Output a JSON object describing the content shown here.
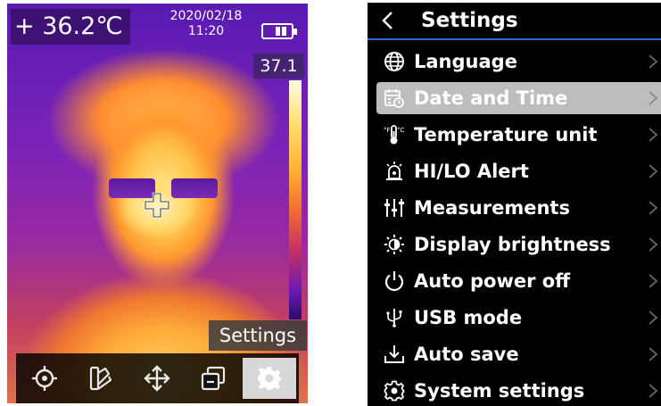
{
  "camera": {
    "spot_temperature": "+ 36.2℃",
    "date": "2020/02/18",
    "time": "11:20",
    "scale_max": "37.1",
    "tooltip": "Settings",
    "battery_level": 0.66,
    "toolbar": [
      {
        "icon": "target-icon",
        "active": false
      },
      {
        "icon": "palette-icon",
        "active": false
      },
      {
        "icon": "move-icon",
        "active": false
      },
      {
        "icon": "gallery-icon",
        "active": false
      },
      {
        "icon": "gear-icon",
        "active": true
      }
    ]
  },
  "settings": {
    "title": "Settings",
    "items": [
      {
        "label": "Language",
        "icon": "globe-icon",
        "selected": false
      },
      {
        "label": "Date and Time",
        "icon": "calendar-clock-icon",
        "selected": true
      },
      {
        "label": "Temperature unit",
        "icon": "thermometer-icon",
        "selected": false
      },
      {
        "label": "HI/LO Alert",
        "icon": "alarm-icon",
        "selected": false
      },
      {
        "label": "Measurements",
        "icon": "sliders-icon",
        "selected": false
      },
      {
        "label": "Display brightness",
        "icon": "brightness-icon",
        "selected": false
      },
      {
        "label": "Auto power off",
        "icon": "power-icon",
        "selected": false
      },
      {
        "label": "USB mode",
        "icon": "usb-icon",
        "selected": false
      },
      {
        "label": "Auto save",
        "icon": "download-icon",
        "selected": false
      },
      {
        "label": "System settings",
        "icon": "system-gear-icon",
        "selected": false
      }
    ]
  },
  "colors": {
    "selected_row": "#bdbdbd",
    "header_rule": "#2a6ccf",
    "menu_background": "#000000"
  }
}
